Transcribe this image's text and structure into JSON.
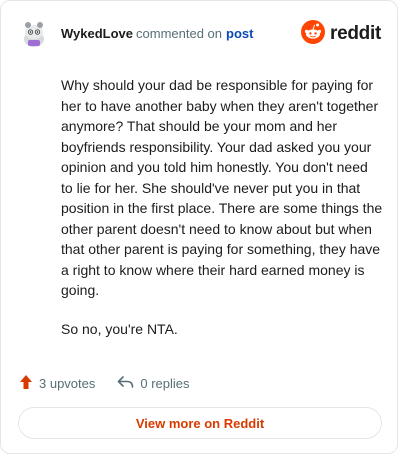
{
  "header": {
    "username": "WykedLove",
    "meta_text": "commented on",
    "post_link": "post",
    "brand_word": "reddit"
  },
  "comment": {
    "paragraphs": [
      "Why should your dad be responsible for paying for her to have another baby when they aren't together anymore? That should be your mom and her boyfriends responsibility. Your dad asked you your opinion and you told him honestly. You don't need to lie for her. She should've never put you in that position in the first place. There are some things the other parent doesn't need to know about but when that other parent is paying for something, they have a right to know where their hard earned money is going.",
      "So no, you're NTA."
    ]
  },
  "actions": {
    "upvotes": "3 upvotes",
    "replies": "0 replies"
  },
  "footer": {
    "view_more": "View more on Reddit"
  },
  "colors": {
    "reddit_orange": "#ff4500",
    "link_blue": "#0a4bb3",
    "cta_orange": "#d93a00",
    "muted": "#576f76",
    "upvote_icon": "#d93a00"
  },
  "icons": {
    "avatar": "snoo-avatar-icon",
    "brand": "reddit-logo-icon",
    "upvote": "upvote-arrow-icon",
    "reply": "reply-arrow-icon"
  }
}
